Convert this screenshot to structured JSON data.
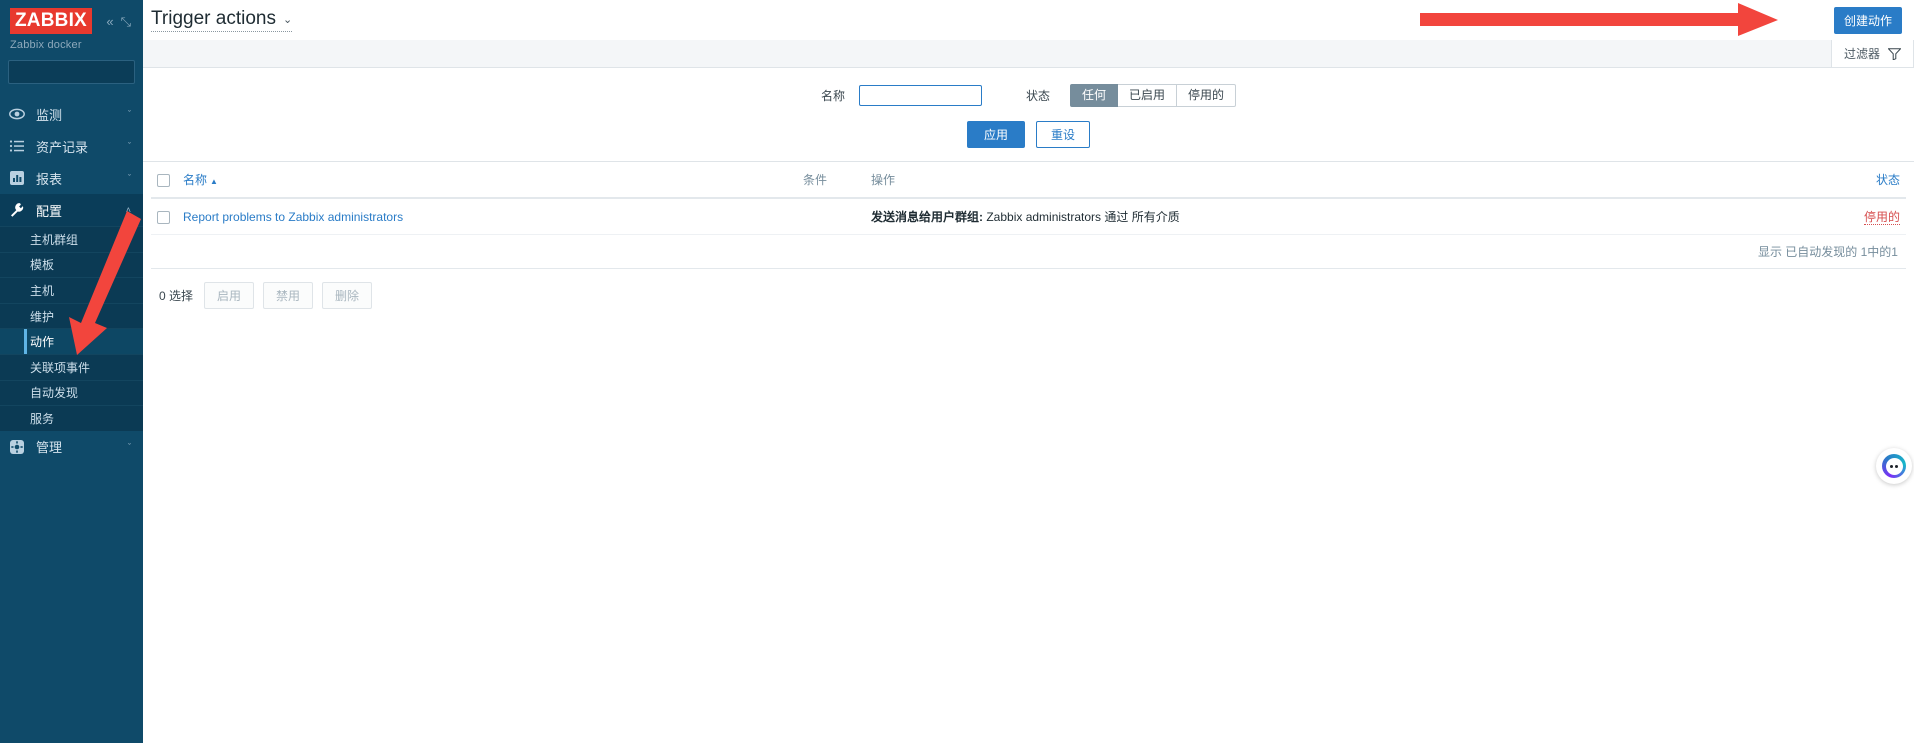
{
  "sidebar": {
    "logo_text": "ZABBIX",
    "collapse_icon": "«",
    "expand_icon": "⤡",
    "server_name": "Zabbix docker",
    "search_placeholder": "",
    "search_value": "",
    "search_icon": "search-icon",
    "nav": [
      {
        "label": "监测",
        "icon": "eye-icon",
        "chevron": "ˇ",
        "active": false
      },
      {
        "label": "资产记录",
        "icon": "list-icon",
        "chevron": "ˇ",
        "active": false
      },
      {
        "label": "报表",
        "icon": "chart-icon",
        "chevron": "ˇ",
        "active": false
      },
      {
        "label": "配置",
        "icon": "wrench-icon",
        "chevron": "˄",
        "active": true
      },
      {
        "label": "管理",
        "icon": "gear-icon",
        "chevron": "ˇ",
        "active": false
      }
    ],
    "subnav": [
      {
        "label": "主机群组",
        "selected": false
      },
      {
        "label": "模板",
        "selected": false
      },
      {
        "label": "主机",
        "selected": false
      },
      {
        "label": "维护",
        "selected": false
      },
      {
        "label": "动作",
        "selected": true
      },
      {
        "label": "关联项事件",
        "selected": false
      },
      {
        "label": "自动发现",
        "selected": false
      },
      {
        "label": "服务",
        "selected": false
      }
    ]
  },
  "header": {
    "title": "Trigger actions",
    "title_chevron": "⌄",
    "create_button": "创建动作"
  },
  "filter": {
    "tab_label": "过滤器",
    "tab_icon": "filter-funnel-icon",
    "name_label": "名称",
    "name_value": "",
    "name_placeholder": "",
    "status_label": "状态",
    "status_options": [
      "任何",
      "已启用",
      "停用的"
    ],
    "status_selected": "任何",
    "apply_button": "应用",
    "reset_button": "重设"
  },
  "table": {
    "columns": {
      "name": "名称",
      "sort_arrow": "▲",
      "conditions": "条件",
      "operations": "操作",
      "status": "状态"
    },
    "rows": [
      {
        "name": "Report problems to Zabbix administrators",
        "conditions": "",
        "operation_label": "发送消息给用户群组:",
        "operation_value": "Zabbix administrators 通过 所有介质",
        "status": "停用的"
      }
    ],
    "count_text": "显示 已自动发现的 1中的1"
  },
  "footer": {
    "selected_text": "0 选择",
    "buttons": [
      "启用",
      "禁用",
      "删除"
    ]
  },
  "annotations": {
    "arrow_color": "#f2453d",
    "arrow_top_right": "points-to-create-action-button",
    "arrow_sidebar": "points-to-actions-menu-item"
  },
  "widget": {
    "name": "floating-assistant-widget"
  },
  "colors": {
    "sidebar_bg": "#0f4a69",
    "accent_blue": "#2a7cc7",
    "logo_red": "#e8392e",
    "status_red": "#d64e4e"
  }
}
